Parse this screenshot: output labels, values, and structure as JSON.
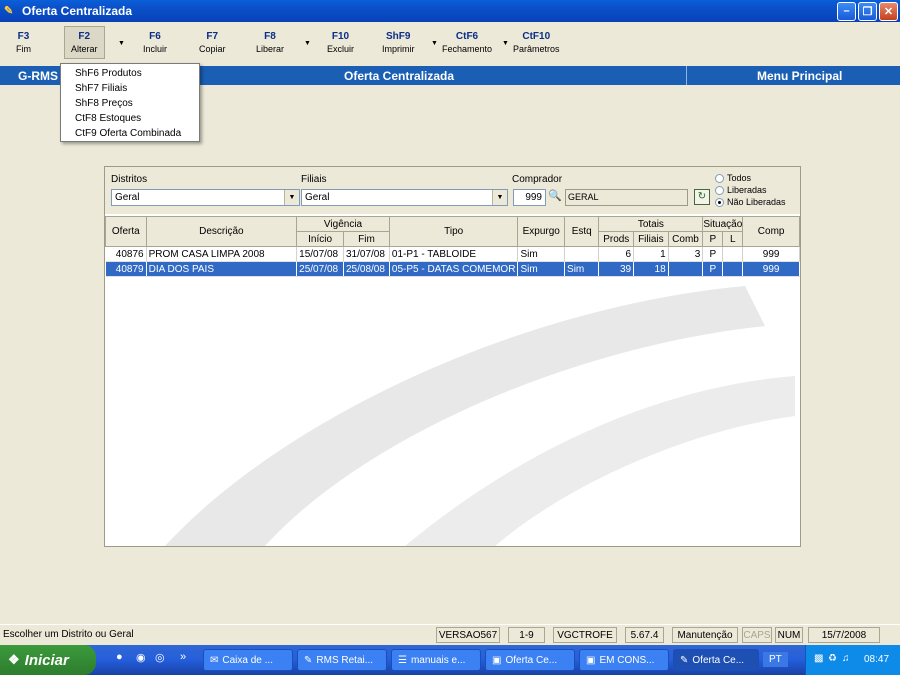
{
  "window": {
    "title": "Oferta Centralizada"
  },
  "toolbar": {
    "buttons": [
      {
        "key": "F3",
        "label": "Fim"
      },
      {
        "key": "F2",
        "label": "Alterar"
      },
      {
        "key": "F6",
        "label": "Incluir"
      },
      {
        "key": "F7",
        "label": "Copiar"
      },
      {
        "key": "F8",
        "label": "Liberar"
      },
      {
        "key": "F10",
        "label": "Excluir"
      },
      {
        "key": "ShF9",
        "label": "Imprimir"
      },
      {
        "key": "CtF6",
        "label": "Fechamento"
      },
      {
        "key": "CtF10",
        "label": "Parâmetros"
      }
    ]
  },
  "menu": {
    "items": [
      "ShF6 Produtos",
      "ShF7 Filiais",
      "ShF8 Preços",
      "CtF8 Estoques",
      "CtF9 Oferta Combinada"
    ]
  },
  "header": {
    "left": "G-RMS",
    "center": "Oferta Centralizada",
    "right": "Menu Principal"
  },
  "filters": {
    "distritos_label": "Distritos",
    "distritos_value": "Geral",
    "filiais_label": "Filiais",
    "filiais_value": "Geral",
    "comprador_label": "Comprador",
    "comprador_code": "999",
    "comprador_name": "GERAL",
    "radios": [
      "Todos",
      "Liberadas",
      "Não Liberadas"
    ],
    "radio_selected": "Não Liberadas"
  },
  "table": {
    "headers": {
      "oferta": "Oferta",
      "descricao": "Descrição",
      "vigencia": "Vigência",
      "inicio": "Início",
      "fim": "Fim",
      "tipo": "Tipo",
      "expurgo": "Expurgo",
      "estq": "Estq",
      "totais": "Totais",
      "prods": "Prods",
      "filiais": "Filiais",
      "comb": "Comb",
      "situacao": "Situação",
      "p": "P",
      "l": "L",
      "comp": "Comp"
    },
    "rows": [
      {
        "oferta": "40876",
        "descricao": "PROM CASA LIMPA 2008",
        "inicio": "15/07/08",
        "fim": "31/07/08",
        "tipo": "01-P1 - TABLOIDE",
        "expurgo": "Sim",
        "estq": "",
        "prods": "6",
        "filiais": "1",
        "comb": "3",
        "p": "P",
        "l": "",
        "comp": "999"
      },
      {
        "oferta": "40879",
        "descricao": "DIA DOS PAIS",
        "inicio": "25/07/08",
        "fim": "25/08/08",
        "tipo": "05-P5 - DATAS COMEMOR",
        "expurgo": "Sim",
        "estq": "Sim",
        "prods": "39",
        "filiais": "18",
        "comb": "",
        "p": "P",
        "l": "",
        "comp": "999"
      }
    ]
  },
  "status": {
    "message": "Escolher um Distrito ou Geral",
    "version": "VERSAO567",
    "page": "1-9",
    "program": "VGCTROFE",
    "build": "5.67.4",
    "mode": "Manutenção",
    "caps": "CAPS",
    "num": "NUM",
    "date": "15/7/2008"
  },
  "taskbar": {
    "start": "Iniciar",
    "tasks": [
      "Caixa de ...",
      "RMS Retai...",
      "manuais e...",
      "Oferta Ce...",
      "EM CONS...",
      "Oferta Ce..."
    ],
    "lang": "PT",
    "clock": "08:47"
  },
  "colors": {
    "selection": "#316ac5",
    "header_blue": "#1a5fb4",
    "toolbar_key": "#0b2e86"
  }
}
